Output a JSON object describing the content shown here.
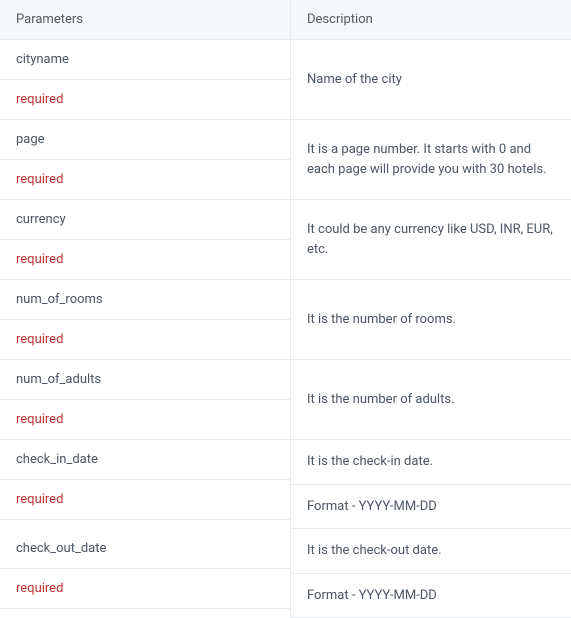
{
  "headers": {
    "parameters": "Parameters",
    "description": "Description"
  },
  "rows": [
    {
      "param": "cityname",
      "required": "required",
      "desc": "Name of the city"
    },
    {
      "param": "page",
      "required": "required",
      "desc": "It is a page number. It starts with 0 and each page will provide you with 30 hotels."
    },
    {
      "param": "currency",
      "required": "required",
      "desc": "It could be any currency like USD, INR, EUR, etc."
    },
    {
      "param": "num_of_rooms",
      "required": "required",
      "desc": "It is the number of rooms."
    },
    {
      "param": "num_of_adults",
      "required": "required",
      "desc": "It is the number of adults."
    }
  ],
  "split_rows": [
    {
      "param": "check_in_date",
      "required": "required",
      "desc1": "It is the check-in date.",
      "desc2": "Format - YYYY-MM-DD"
    },
    {
      "param": "check_out_date",
      "required": "required",
      "desc1": "It is the check-out date.",
      "desc2": "Format - YYYY-MM-DD"
    }
  ]
}
